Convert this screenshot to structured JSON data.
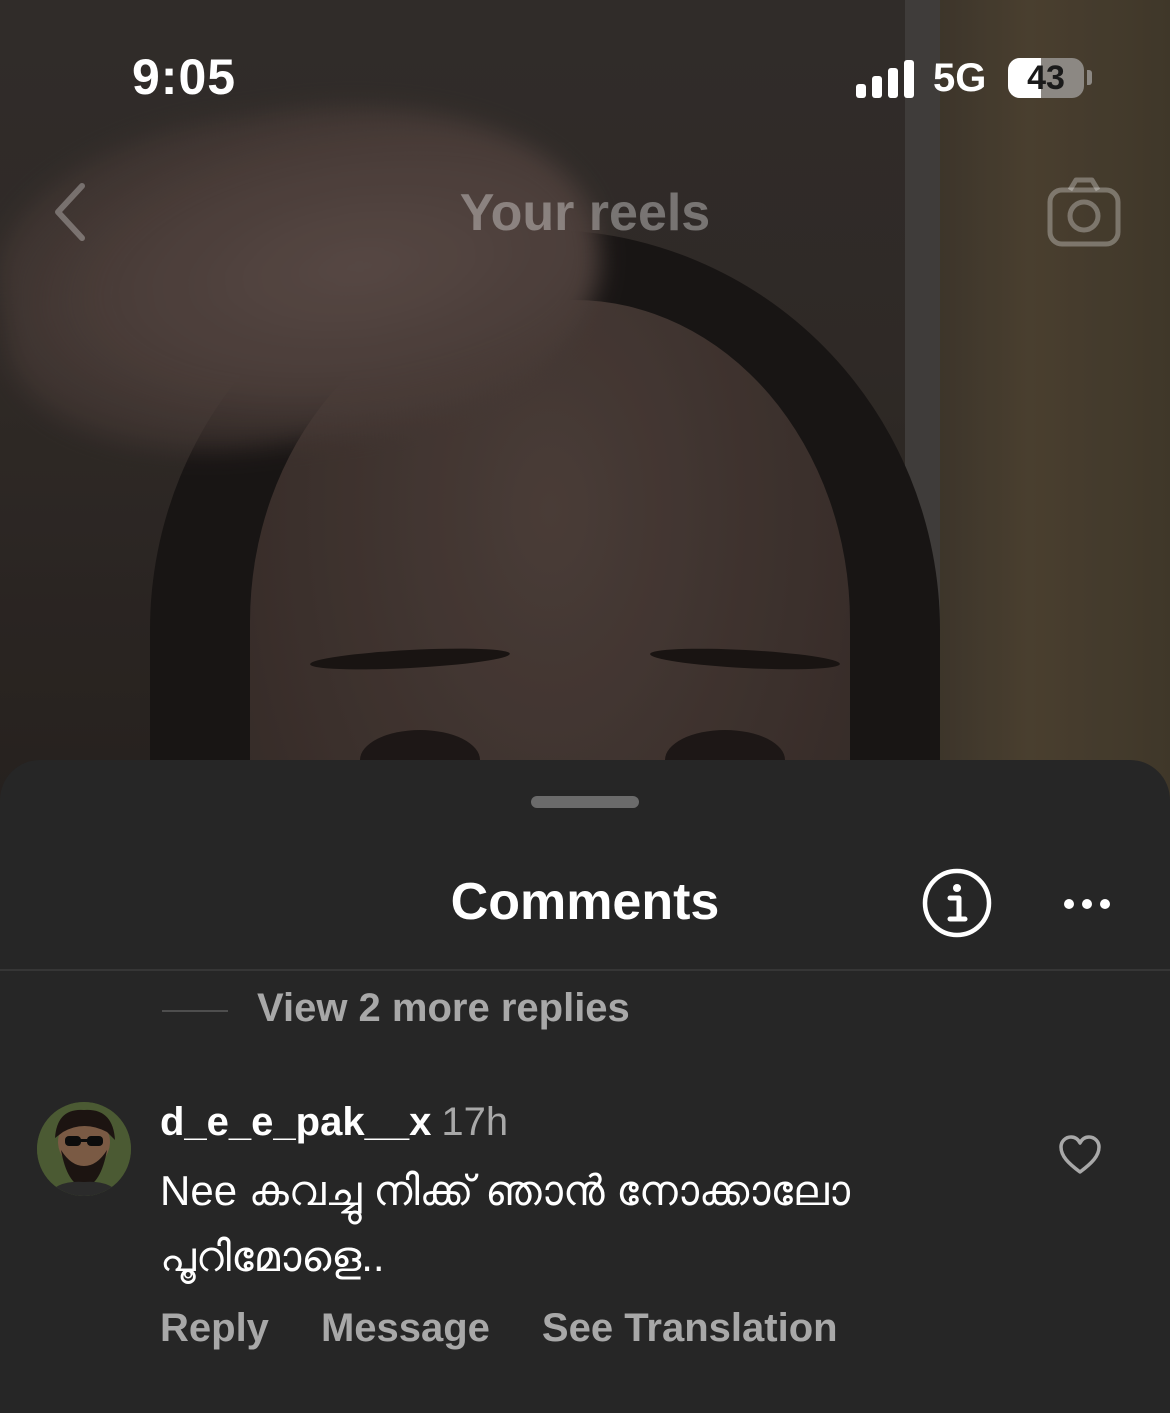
{
  "status_bar": {
    "time": "9:05",
    "network": "5G",
    "battery": "43",
    "battery_level": 0.43
  },
  "reel_header": {
    "title": "Your reels",
    "back_icon": "chevron-left-icon",
    "camera_icon": "camera-icon"
  },
  "comments_sheet": {
    "title": "Comments",
    "info_icon": "info-icon",
    "more_icon": "more-horizontal-icon",
    "view_replies": "View 2 more replies",
    "comment": {
      "username": "d_e_e_pak__x",
      "time": "17h",
      "text": "Nee കവച്ചു നിക്ക് ഞാൻ നോക്കാലോ പൂറിമോളെ..",
      "actions": {
        "reply": "Reply",
        "message": "Message",
        "see_translation": "See Translation"
      },
      "like_icon": "heart-icon"
    }
  },
  "colors": {
    "sheet_bg": "#262626",
    "secondary_text": "#a8a8a8",
    "primary_text": "#ffffff"
  }
}
